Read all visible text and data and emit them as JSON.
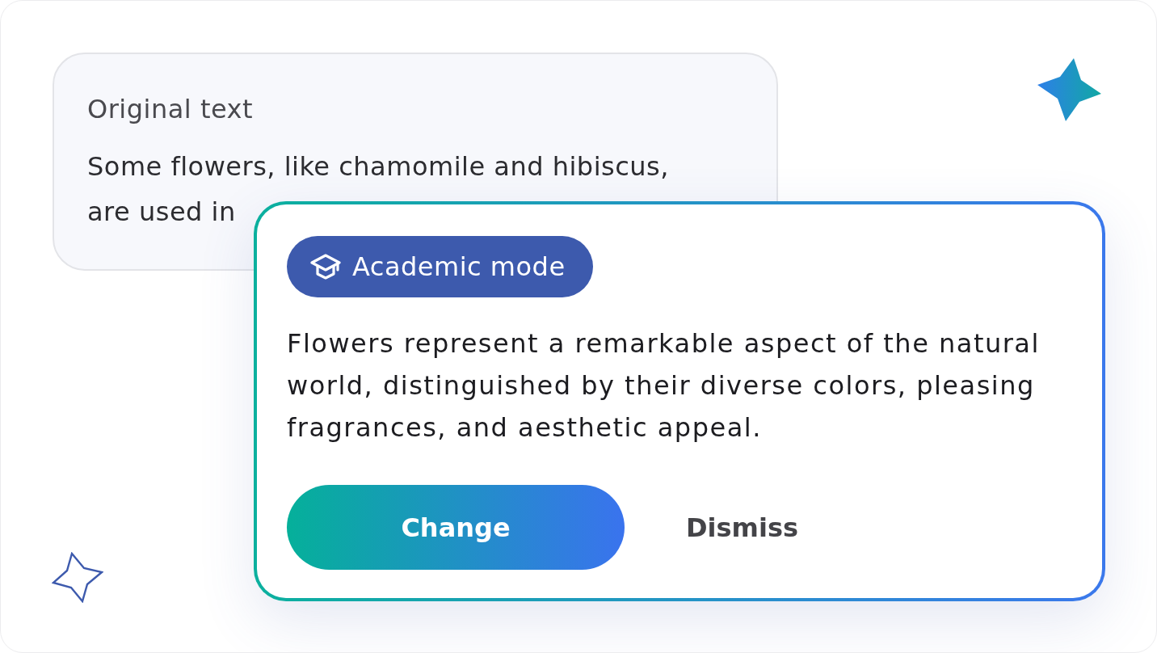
{
  "original_card": {
    "title": "Original text",
    "text": "Some flowers, like chamomile and hibiscus, are used in"
  },
  "suggestion_card": {
    "badge": {
      "label": "Academic mode"
    },
    "text": "Flowers represent a remarkable aspect of the natural world, distinguished by their diverse colors, pleasing fragrances, and aesthetic appeal.",
    "buttons": [
      {
        "label": "Change",
        "kind": "primary"
      },
      {
        "label": "Dismiss",
        "kind": "secondary"
      }
    ]
  }
}
